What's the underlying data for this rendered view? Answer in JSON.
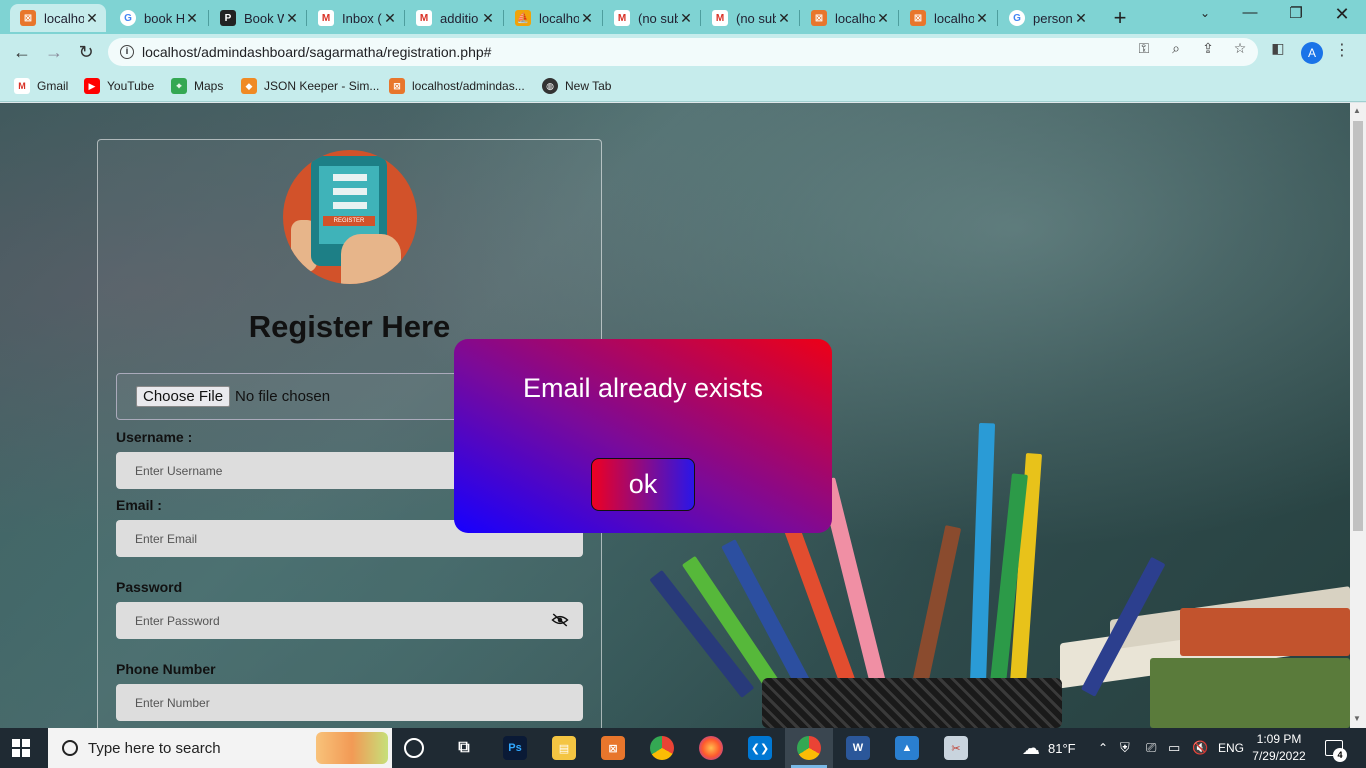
{
  "browser": {
    "tabs": [
      {
        "title": "localhost/admindashboard/sagarmatha/registration.php",
        "icon": "xampp-icon",
        "color": "#e8762c"
      },
      {
        "title": "book H",
        "icon": "google-icon",
        "color": "#4285f4"
      },
      {
        "title": "Book W",
        "icon": "pdf-app-icon",
        "color": "#222222"
      },
      {
        "title": "Inbox (",
        "icon": "gmail-icon",
        "color": "#d93025"
      },
      {
        "title": "additio",
        "icon": "gmail-icon",
        "color": "#d93025"
      },
      {
        "title": "localho",
        "icon": "phpmyadmin-icon",
        "color": "#f0a30a"
      },
      {
        "title": "(no sub",
        "icon": "gmail-icon",
        "color": "#d93025"
      },
      {
        "title": "(no sub",
        "icon": "gmail-icon",
        "color": "#d93025"
      },
      {
        "title": "localho",
        "icon": "xampp-icon",
        "color": "#e8762c"
      },
      {
        "title": "localho",
        "icon": "xampp-icon",
        "color": "#e8762c"
      },
      {
        "title": "person",
        "icon": "google-icon",
        "color": "#4285f4"
      }
    ],
    "tab_display": [
      "localho",
      "book H",
      "Book W",
      "Inbox (",
      "additio",
      "localho",
      "(no sub",
      "(no sub",
      "localho",
      "localho",
      "person"
    ],
    "url": "localhost/admindashboard/sagarmatha/registration.php#",
    "profile_initial": "A",
    "bookmarks": [
      {
        "label": "Gmail",
        "icon": "gmail-icon"
      },
      {
        "label": "YouTube",
        "icon": "youtube-icon"
      },
      {
        "label": "Maps",
        "icon": "maps-icon"
      },
      {
        "label": "JSON Keeper - Sim...",
        "icon": "json-keeper-icon"
      },
      {
        "label": "localhost/admindas...",
        "icon": "xampp-icon"
      },
      {
        "label": "New Tab",
        "icon": "globe-icon"
      }
    ]
  },
  "form": {
    "heading": "Register Here",
    "logo_text": "REGISTER",
    "file_button": "Choose File",
    "file_status": "No file chosen",
    "username_label": "Username :",
    "username_placeholder": "Enter Username",
    "email_label": "Email :",
    "email_placeholder": "Enter Email",
    "password_label": "Password",
    "password_placeholder": "Enter Password",
    "phone_label": "Phone Number",
    "phone_placeholder": "Enter Number"
  },
  "modal": {
    "message": "Email already exists",
    "ok_label": "ok",
    "gradient": [
      "#ee0016",
      "#1600ff"
    ]
  },
  "taskbar": {
    "search_placeholder": "Type here to search",
    "apps": [
      "task-view-icon",
      "photoshop-icon",
      "file-explorer-icon",
      "xampp-icon",
      "chrome-icon",
      "firefox-icon",
      "vscode-icon",
      "chrome-profile-icon",
      "word-icon",
      "photos-icon",
      "snipping-icon"
    ],
    "weather": "81°F",
    "language": "ENG",
    "time": "1:09 PM",
    "date": "7/29/2022",
    "notifications": "4"
  }
}
